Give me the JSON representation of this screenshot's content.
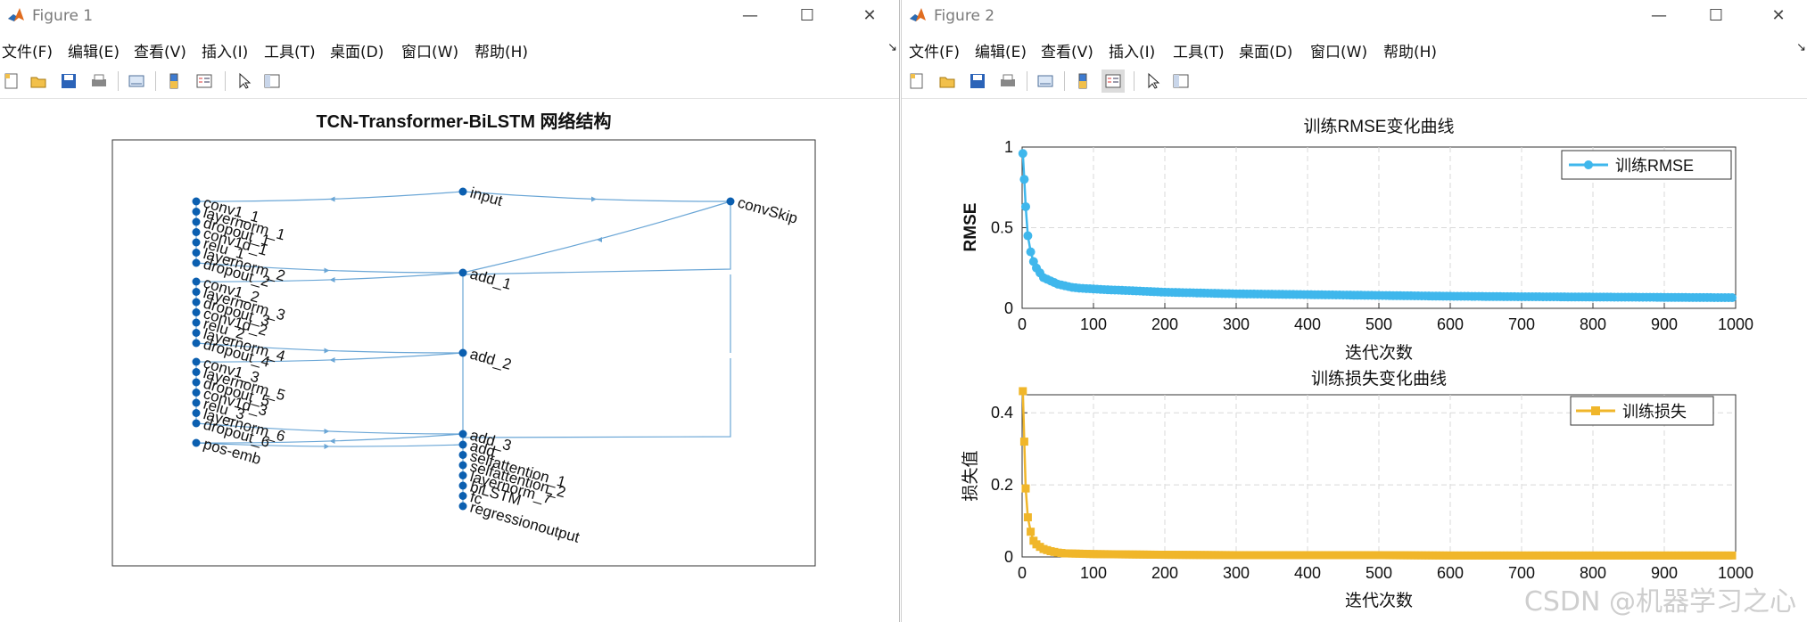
{
  "figure1": {
    "window_title": "Figure 1",
    "menus": [
      "文件(F)",
      "编辑(E)",
      "查看(V)",
      "插入(I)",
      "工具(T)",
      "桌面(D)",
      "窗口(W)",
      "帮助(H)"
    ],
    "menu_overflow": "↘",
    "toolbar_icons": [
      "new-figure-icon",
      "open-file-icon",
      "save-icon",
      "print-icon",
      "link-plot-icon",
      "colorbar-icon",
      "legend-icon",
      "pointer-icon",
      "property-inspector-icon"
    ]
  },
  "figure2": {
    "window_title": "Figure 2",
    "menus": [
      "文件(F)",
      "编辑(E)",
      "查看(V)",
      "插入(I)",
      "工具(T)",
      "桌面(D)",
      "窗口(W)",
      "帮助(H)"
    ],
    "menu_overflow": "↘",
    "toolbar_icons": [
      "new-figure-icon",
      "open-file-icon",
      "save-icon",
      "print-icon",
      "link-plot-icon",
      "colorbar-icon",
      "legend-icon",
      "pointer-icon",
      "property-inspector-icon"
    ]
  },
  "watermark": "CSDN @机器学习之心",
  "colors": {
    "edge": "#6aa6d6",
    "node": "#0b5fb0",
    "rmse": "#3fb7ec",
    "loss": "#f0b62a",
    "frame": "#555555",
    "grid": "#d9d9d9"
  },
  "chart_data": [
    {
      "type": "network-graph",
      "title": "TCN-Transformer-BiLSTM 网络结构",
      "nodes": [
        "input",
        "convSkip",
        "conv1_1",
        "layernorm_1",
        "dropout_1",
        "conv1d_1",
        "relu_1",
        "layernorm_2",
        "dropout_2",
        "add_1",
        "conv1_2",
        "layernorm_3",
        "dropout_3",
        "conv1d_2",
        "relu_2",
        "layernorm_4",
        "dropout_4",
        "add_2",
        "conv1_3",
        "layernorm_5",
        "dropout_5",
        "conv1d_3",
        "relu_3",
        "layernorm_6",
        "dropout_6",
        "pos-emb",
        "add_3",
        "add",
        "selfattention_1",
        "selfattention_2",
        "layernorm_7",
        "biLSTM",
        "fc",
        "regressionoutput"
      ],
      "labels": [
        "input",
        "convSkip",
        "conv1_1",
        "layernorm_1",
        "dropout_1",
        "conv1d_1",
        "relu_1",
        "layernorm_2",
        "dropout_2",
        "add_1",
        "conv1_2",
        "layernorm_3",
        "dropout_3",
        "conv1d_2",
        "relu_2",
        "layernorm_4",
        "dropout_4",
        "add_2",
        "conv1_3",
        "layernorm_5",
        "dropout_5",
        "conv1d_3",
        "relu_3",
        "layernorm_6",
        "dropout_6",
        "pos-emb",
        "add_3",
        "add",
        "selfattention_1",
        "selfattention_2",
        "layernorm_7",
        "biLSTM",
        "fc",
        "regressionoutput"
      ],
      "edges": [
        [
          "input",
          "conv1_1"
        ],
        [
          "input",
          "convSkip"
        ],
        [
          "conv1_1",
          "layernorm_1"
        ],
        [
          "layernorm_1",
          "dropout_1"
        ],
        [
          "dropout_1",
          "conv1d_1"
        ],
        [
          "conv1d_1",
          "relu_1"
        ],
        [
          "relu_1",
          "layernorm_2"
        ],
        [
          "layernorm_2",
          "dropout_2"
        ],
        [
          "dropout_2",
          "add_1"
        ],
        [
          "convSkip",
          "add_1"
        ],
        [
          "add_1",
          "conv1_2"
        ],
        [
          "add_1",
          "add_2"
        ],
        [
          "conv1_2",
          "layernorm_3"
        ],
        [
          "layernorm_3",
          "dropout_3"
        ],
        [
          "dropout_3",
          "conv1d_2"
        ],
        [
          "conv1d_2",
          "relu_2"
        ],
        [
          "relu_2",
          "layernorm_4"
        ],
        [
          "layernorm_4",
          "dropout_4"
        ],
        [
          "dropout_4",
          "add_2"
        ],
        [
          "add_2",
          "conv1_3"
        ],
        [
          "add_2",
          "add_3"
        ],
        [
          "conv1_3",
          "layernorm_5"
        ],
        [
          "layernorm_5",
          "dropout_5"
        ],
        [
          "dropout_5",
          "conv1d_3"
        ],
        [
          "conv1d_3",
          "relu_3"
        ],
        [
          "relu_3",
          "layernorm_6"
        ],
        [
          "layernorm_6",
          "dropout_6"
        ],
        [
          "dropout_6",
          "add_3"
        ],
        [
          "add_3",
          "pos-emb"
        ],
        [
          "add_3",
          "add"
        ],
        [
          "pos-emb",
          "add"
        ],
        [
          "add",
          "selfattention_1"
        ],
        [
          "selfattention_1",
          "selfattention_2"
        ],
        [
          "selfattention_2",
          "layernorm_7"
        ],
        [
          "layernorm_7",
          "biLSTM"
        ],
        [
          "biLSTM",
          "fc"
        ],
        [
          "fc",
          "regressionoutput"
        ]
      ]
    },
    {
      "type": "line",
      "title": "训练RMSE变化曲线",
      "xlabel": "迭代次数",
      "ylabel": "RMSE",
      "xlim": [
        0,
        1000
      ],
      "ylim": [
        0,
        1
      ],
      "xticks": [
        "0",
        "100",
        "200",
        "300",
        "400",
        "500",
        "600",
        "700",
        "800",
        "900",
        "1000"
      ],
      "yticks": [
        "0",
        "0.5",
        "1"
      ],
      "grid": true,
      "legend_position": "top-right",
      "series": [
        {
          "name": "训练RMSE",
          "marker": "circle",
          "x": [
            1,
            3,
            5,
            8,
            12,
            16,
            20,
            25,
            30,
            40,
            50,
            60,
            70,
            80,
            100,
            120,
            150,
            200,
            250,
            300,
            400,
            500,
            600,
            700,
            800,
            900,
            1000
          ],
          "y": [
            0.96,
            0.8,
            0.63,
            0.45,
            0.35,
            0.29,
            0.25,
            0.22,
            0.19,
            0.17,
            0.15,
            0.14,
            0.13,
            0.125,
            0.12,
            0.115,
            0.11,
            0.1,
            0.095,
            0.09,
            0.085,
            0.08,
            0.075,
            0.072,
            0.07,
            0.068,
            0.066
          ]
        }
      ]
    },
    {
      "type": "line",
      "title": "训练损失变化曲线",
      "xlabel": "迭代次数",
      "ylabel": "损失值",
      "xlim": [
        0,
        1000
      ],
      "ylim": [
        0,
        0.45
      ],
      "xticks": [
        "0",
        "100",
        "200",
        "300",
        "400",
        "500",
        "600",
        "700",
        "800",
        "900",
        "1000"
      ],
      "yticks": [
        "0",
        "0.2",
        "0.4"
      ],
      "grid": true,
      "legend_position": "top-right",
      "series": [
        {
          "name": "训练损失",
          "marker": "square",
          "x": [
            1,
            3,
            5,
            8,
            12,
            16,
            20,
            25,
            30,
            40,
            50,
            60,
            80,
            100,
            150,
            200,
            300,
            400,
            500,
            600,
            700,
            800,
            900,
            1000
          ],
          "y": [
            0.46,
            0.32,
            0.19,
            0.11,
            0.07,
            0.045,
            0.035,
            0.028,
            0.022,
            0.016,
            0.012,
            0.01,
            0.009,
            0.008,
            0.007,
            0.006,
            0.005,
            0.005,
            0.005,
            0.004,
            0.004,
            0.004,
            0.004,
            0.004
          ]
        }
      ]
    }
  ]
}
